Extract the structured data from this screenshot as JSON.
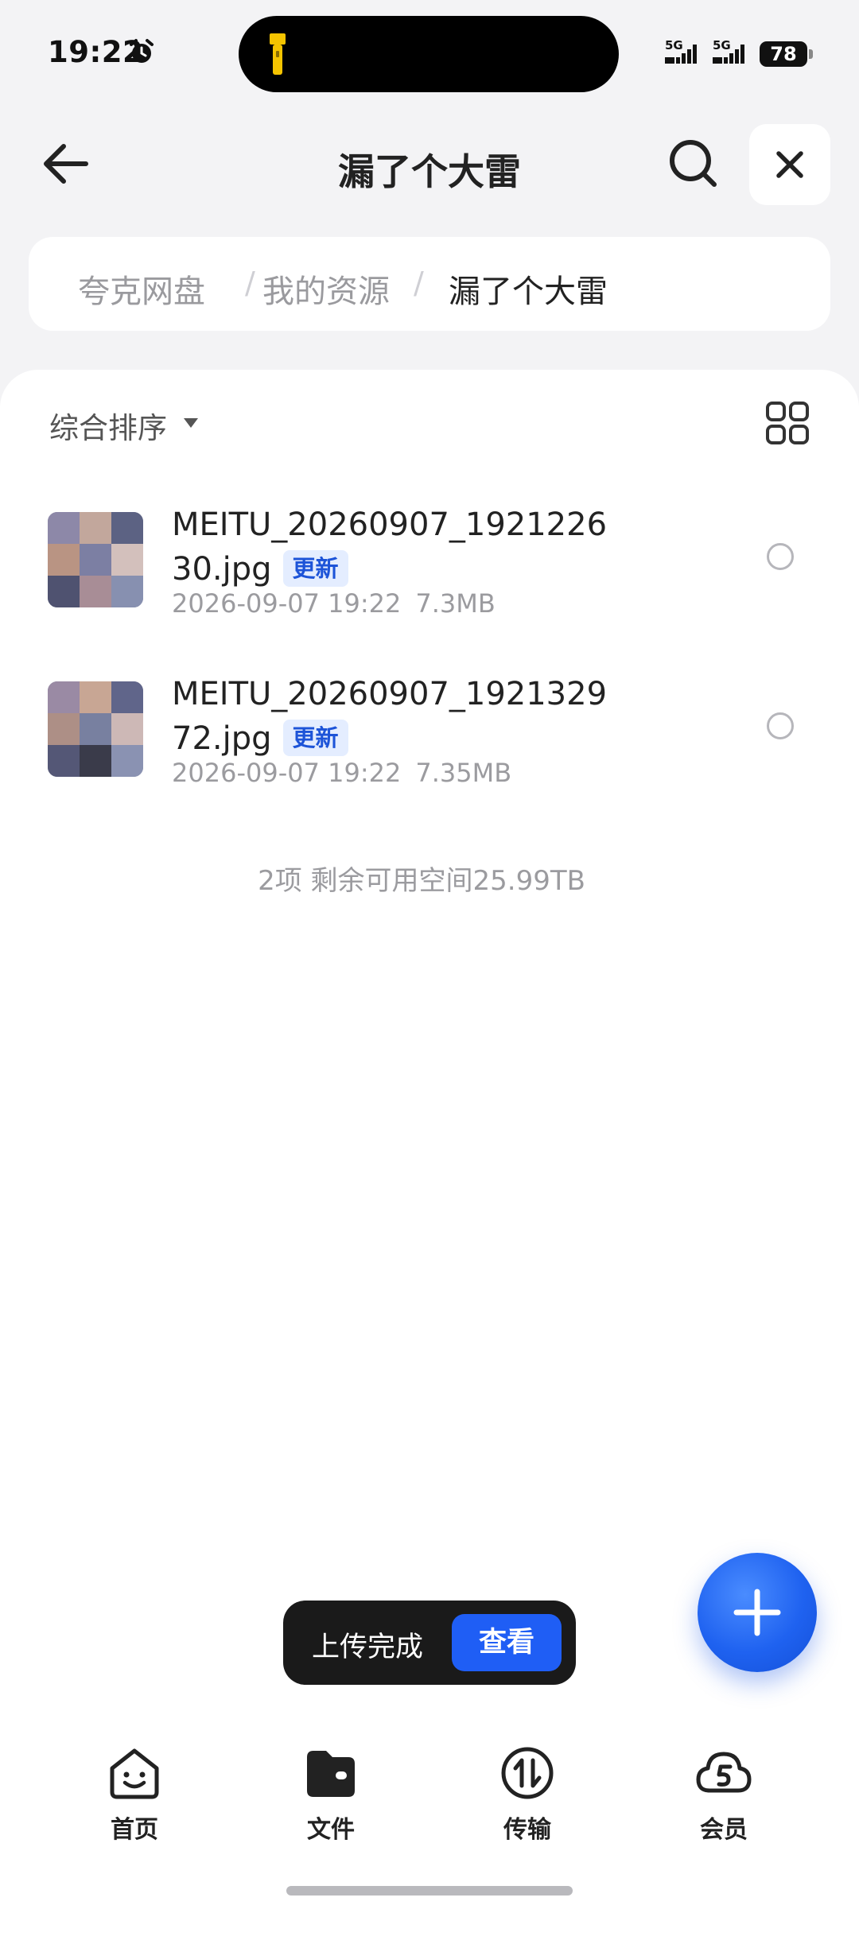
{
  "status_bar": {
    "time": "19:22",
    "sim1_label": "5G",
    "sim2_label": "5G",
    "battery": "78"
  },
  "header": {
    "title": "漏了个大雷"
  },
  "breadcrumb": [
    "夸克网盘",
    "我的资源",
    "漏了个大雷"
  ],
  "toolbar": {
    "sort_label": "综合排序"
  },
  "files": [
    {
      "name": "MEITU_20260907_192122630.jpg",
      "badge": "更新",
      "date": "2026-09-07 19:22",
      "size": "7.3MB"
    },
    {
      "name": "MEITU_20260907_192132972.jpg",
      "badge": "更新",
      "date": "2026-09-07 19:22",
      "size": "7.35MB"
    }
  ],
  "summary": "2项 剩余可用空间25.99TB",
  "toast": {
    "message": "上传完成",
    "action": "查看"
  },
  "bottom_nav": [
    {
      "label": "首页",
      "icon": "home-face-icon"
    },
    {
      "label": "文件",
      "icon": "folder-icon"
    },
    {
      "label": "传输",
      "icon": "transfer-icon"
    },
    {
      "label": "会员",
      "icon": "vip-cloud-icon"
    }
  ],
  "colors": {
    "accent": "#1f5ef5",
    "badge_bg": "#e4edff",
    "badge_text": "#1d54d8",
    "page_bg": "#f3f3f5"
  }
}
